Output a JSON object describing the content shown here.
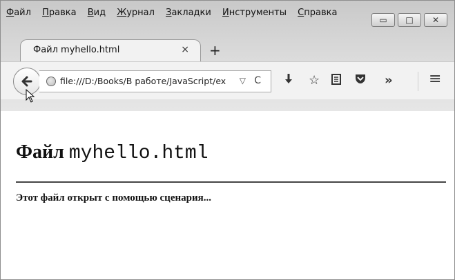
{
  "menu": {
    "items": [
      {
        "label": "Файл"
      },
      {
        "label": "Правка"
      },
      {
        "label": "Вид"
      },
      {
        "label": "Журнал"
      },
      {
        "label": "Закладки"
      },
      {
        "label": "Инструменты"
      },
      {
        "label": "Справка"
      }
    ]
  },
  "window_controls": {
    "minimize": "▭",
    "maximize": "□",
    "close": "✕"
  },
  "tab": {
    "title": "Файл myhello.html",
    "close": "×",
    "new_tab": "+"
  },
  "nav": {
    "url": "file:///D:/Books/В работе/JavaScript/ex",
    "dropdown": "▽",
    "reload": "C",
    "download_icon": "download-icon",
    "bookmark_icon": "star-icon",
    "reading_list_icon": "reading-list-icon",
    "pocket_icon": "pocket-icon",
    "overflow": "»",
    "menu": "≡"
  },
  "page": {
    "heading_prefix": "Файл",
    "heading_code": "myhello.html",
    "paragraph": "Этот файл открыт с помощью сценария..."
  },
  "colors": {
    "chrome_top": "#c9c9c9",
    "chrome_bottom": "#f2f2f2",
    "divider": "#444444"
  }
}
